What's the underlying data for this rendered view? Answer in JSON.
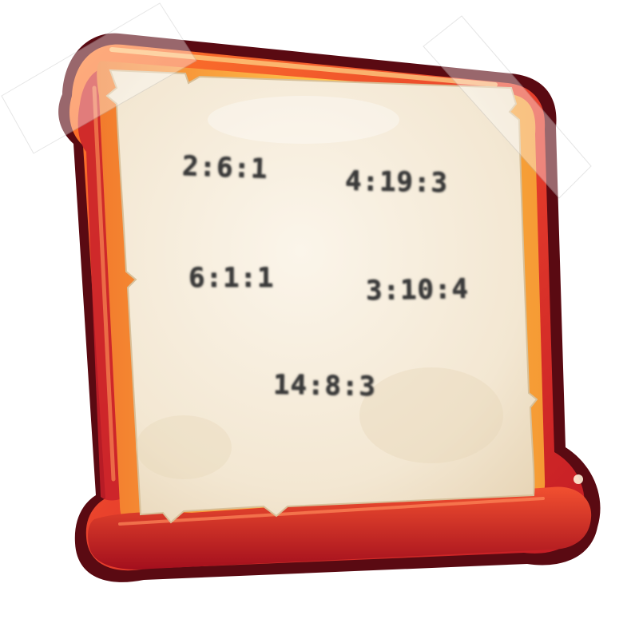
{
  "board": {
    "codes": [
      "2:6:1",
      "4:19:3",
      "6:1:1",
      "3:10:4",
      "14:8:3"
    ]
  },
  "colors": {
    "frame_dark": "#b3121f",
    "frame_mid": "#e8402c",
    "frame_light": "#f9a33a",
    "frame_glow": "#ffd35c",
    "paper": "#f4ead6",
    "ink": "#3a3a3a"
  },
  "icons": {
    "tape": "tape-strip"
  }
}
